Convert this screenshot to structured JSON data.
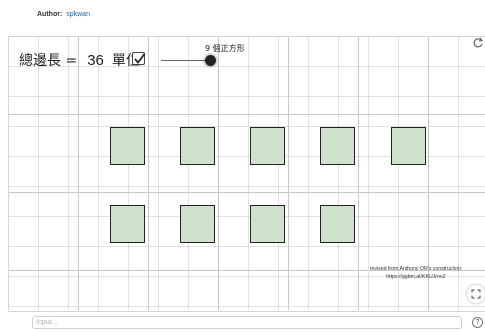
{
  "header": {
    "author_label": "Author:",
    "author_name": "spkwan"
  },
  "applet": {
    "perimeter_label": "總邊長 =",
    "perimeter_value": "36",
    "perimeter_unit": "單位",
    "checkbox_checked": true,
    "slider_caption": "9 個正方形",
    "slider_value": 9,
    "square_count": 9,
    "square_color": "#cfe3cc",
    "credit_line1": "revised from Anthony OR's construction:",
    "credit_line2": "https://ggbm.at/KKUJrnn2"
  },
  "input_bar": {
    "placeholder": "Input..."
  }
}
